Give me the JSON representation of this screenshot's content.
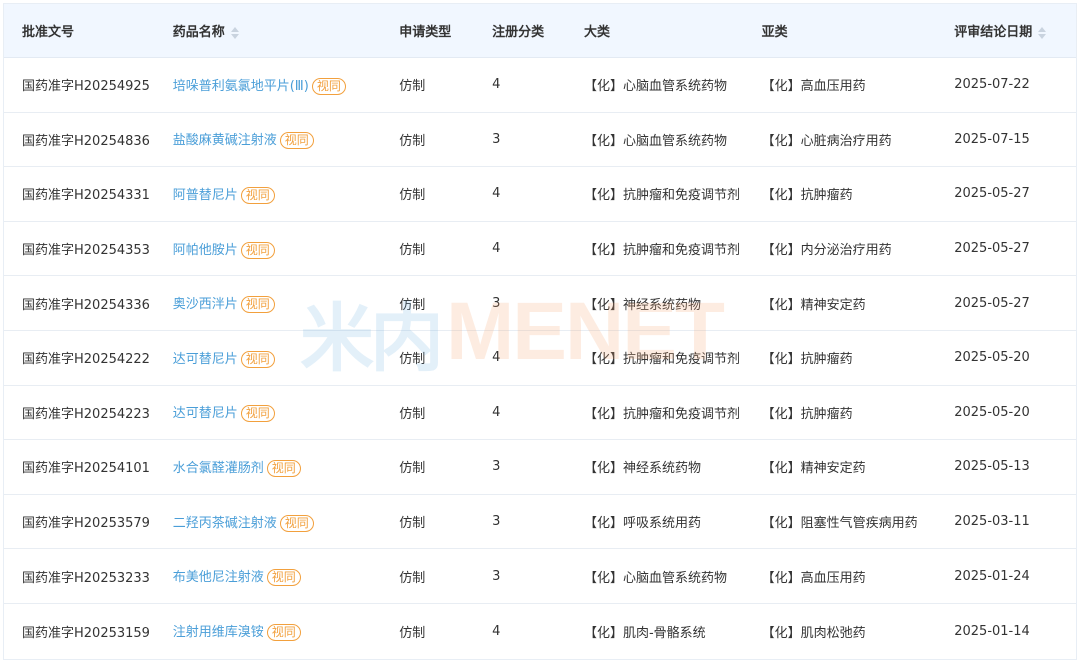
{
  "table": {
    "columns": [
      "批准文号",
      "药品名称",
      "申请类型",
      "注册分类",
      "大类",
      "亚类",
      "评审结论日期"
    ],
    "badge_label": "视同",
    "rows": [
      {
        "approval": "国药准字H20254925",
        "drug": "培哚普利氨氯地平片(Ⅲ)",
        "apply_type": "仿制",
        "reg_class": "4",
        "category": "【化】心脑血管系统药物",
        "subcategory": "【化】高血压用药",
        "date": "2025-07-22"
      },
      {
        "approval": "国药准字H20254836",
        "drug": "盐酸麻黄碱注射液",
        "apply_type": "仿制",
        "reg_class": "3",
        "category": "【化】心脑血管系统药物",
        "subcategory": "【化】心脏病治疗用药",
        "date": "2025-07-15"
      },
      {
        "approval": "国药准字H20254331",
        "drug": "阿普替尼片",
        "apply_type": "仿制",
        "reg_class": "4",
        "category": "【化】抗肿瘤和免疫调节剂",
        "subcategory": "【化】抗肿瘤药",
        "date": "2025-05-27"
      },
      {
        "approval": "国药准字H20254353",
        "drug": "阿帕他胺片",
        "apply_type": "仿制",
        "reg_class": "4",
        "category": "【化】抗肿瘤和免疫调节剂",
        "subcategory": "【化】内分泌治疗用药",
        "date": "2025-05-27"
      },
      {
        "approval": "国药准字H20254336",
        "drug": "奥沙西泮片",
        "apply_type": "仿制",
        "reg_class": "3",
        "category": "【化】神经系统药物",
        "subcategory": "【化】精神安定药",
        "date": "2025-05-27"
      },
      {
        "approval": "国药准字H20254222",
        "drug": "达可替尼片",
        "apply_type": "仿制",
        "reg_class": "4",
        "category": "【化】抗肿瘤和免疫调节剂",
        "subcategory": "【化】抗肿瘤药",
        "date": "2025-05-20"
      },
      {
        "approval": "国药准字H20254223",
        "drug": "达可替尼片",
        "apply_type": "仿制",
        "reg_class": "4",
        "category": "【化】抗肿瘤和免疫调节剂",
        "subcategory": "【化】抗肿瘤药",
        "date": "2025-05-20"
      },
      {
        "approval": "国药准字H20254101",
        "drug": "水合氯醛灌肠剂",
        "apply_type": "仿制",
        "reg_class": "3",
        "category": "【化】神经系统药物",
        "subcategory": "【化】精神安定药",
        "date": "2025-05-13"
      },
      {
        "approval": "国药准字H20253579",
        "drug": "二羟丙茶碱注射液",
        "apply_type": "仿制",
        "reg_class": "3",
        "category": "【化】呼吸系统用药",
        "subcategory": "【化】阻塞性气管疾病用药",
        "date": "2025-03-11"
      },
      {
        "approval": "国药准字H20253233",
        "drug": "布美他尼注射液",
        "apply_type": "仿制",
        "reg_class": "3",
        "category": "【化】心脑血管系统药物",
        "subcategory": "【化】高血压用药",
        "date": "2025-01-24"
      },
      {
        "approval": "国药准字H20253159",
        "drug": "注射用维库溴铵",
        "apply_type": "仿制",
        "reg_class": "4",
        "category": "【化】肌肉-骨骼系统",
        "subcategory": "【化】肌肉松弛药",
        "date": "2025-01-14"
      }
    ]
  },
  "watermark": {
    "cn": "米内",
    "en": "MENET"
  },
  "colors": {
    "header_bg": "#f1f7ff",
    "link": "#4a9ed8",
    "badge": "#f2a03d",
    "border": "#e8edf3"
  }
}
